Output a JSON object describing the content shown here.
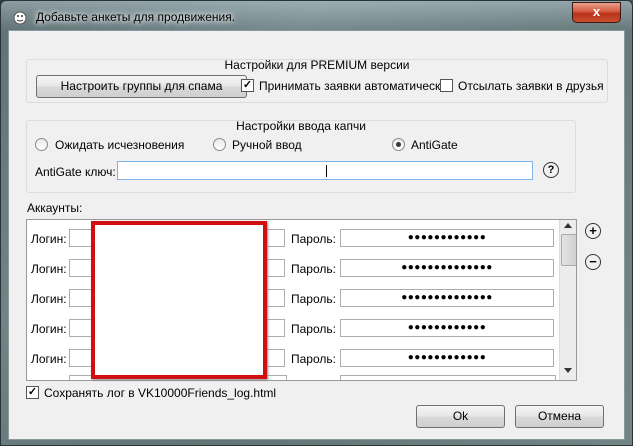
{
  "window": {
    "title": "Добавьте анкеты для продвижения.",
    "close_glyph": "x"
  },
  "premium": {
    "group_title": "Настройки для PREMIUM версии",
    "groups_button": "Настроить группы для спама",
    "auto_accept_label": "Принимать заявки автоматически",
    "auto_accept_checked": true,
    "send_requests_label": "Отсылать заявки в друзья",
    "send_requests_checked": false
  },
  "captcha": {
    "group_title": "Настройки ввода капчи",
    "options": [
      {
        "label": "Ожидать исчезновения",
        "selected": false
      },
      {
        "label": "Ручной ввод",
        "selected": false
      },
      {
        "label": "AntiGate",
        "selected": true
      }
    ],
    "key_label": "AntiGate ключ:",
    "key_value": "",
    "help_glyph": "?"
  },
  "accounts": {
    "label": "Аккаунты:",
    "login_label": "Логин:",
    "password_label": "Пароль:",
    "rows": [
      {
        "password": "●●●●●●●●●●●●"
      },
      {
        "password": "●●●●●●●●●●●●●●"
      },
      {
        "password": "●●●●●●●●●●●●●●"
      },
      {
        "password": "●●●●●●●●●●●●"
      },
      {
        "password": "●●●●●●●●●●●●"
      }
    ],
    "add_glyph": "+",
    "remove_glyph": "−"
  },
  "footer": {
    "save_log_label": "Сохранять лог в VK10000Friends_log.html",
    "save_log_checked": true,
    "ok_button": "Ok",
    "cancel_button": "Отмена"
  },
  "colors": {
    "highlight_border": "#d01010",
    "accent": "#3399ff"
  }
}
